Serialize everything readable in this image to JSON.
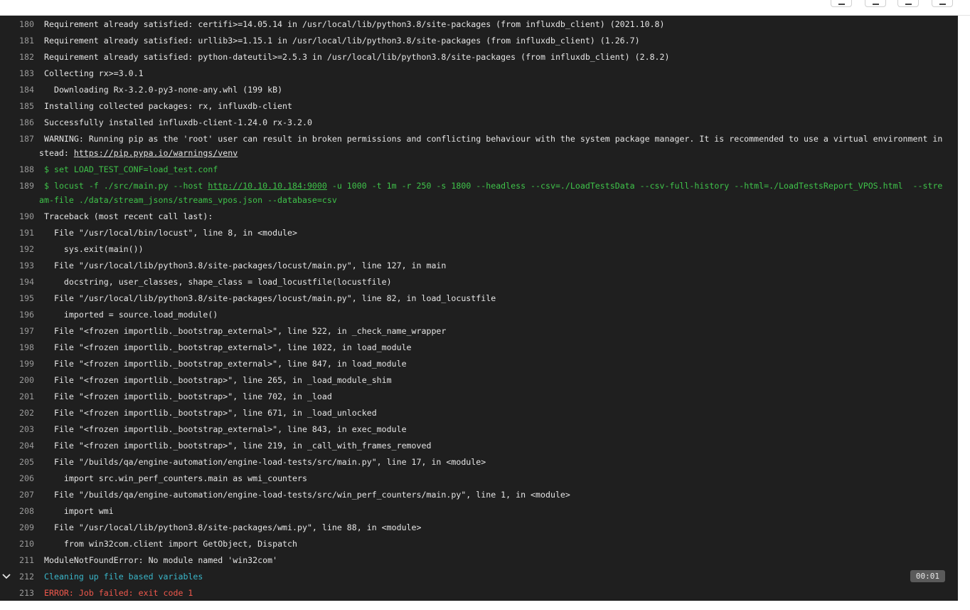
{
  "lines": [
    {
      "n": "180",
      "text": "Requirement already satisfied: certifi>=14.05.14 in /usr/local/lib/python3.8/site-packages (from influxdb_client) (2021.10.8)"
    },
    {
      "n": "181",
      "text": "Requirement already satisfied: urllib3>=1.15.1 in /usr/local/lib/python3.8/site-packages (from influxdb_client) (1.26.7)"
    },
    {
      "n": "182",
      "text": "Requirement already satisfied: python-dateutil>=2.5.3 in /usr/local/lib/python3.8/site-packages (from influxdb_client) (2.8.2)"
    },
    {
      "n": "183",
      "text": "Collecting rx>=3.0.1"
    },
    {
      "n": "184",
      "text": "  Downloading Rx-3.2.0-py3-none-any.whl (199 kB)"
    },
    {
      "n": "185",
      "text": "Installing collected packages: rx, influxdb-client"
    },
    {
      "n": "186",
      "text": "Successfully installed influxdb-client-1.24.0 rx-3.2.0"
    },
    {
      "n": "187",
      "text": "WARNING: Running pip as the 'root' user can result in broken permissions and conflicting behaviour with the system package manager. It is recommended to use a virtual environment instead: ",
      "link": "https://pip.pypa.io/warnings/venv"
    },
    {
      "n": "188",
      "text": "$ set LOAD_TEST_CONF=load_test.conf",
      "color": "green"
    },
    {
      "n": "189",
      "text": "$ locust -f ./src/main.py --host ",
      "link": "http://10.10.10.184:9000",
      "after": " -u 1000 -t 1m -r 250 -s 1800 --headless --csv=./LoadTestsData --csv-full-history --html=./LoadTestsReport_VPOS.html  --stream-file ./data/stream_jsons/streams_vpos.json --database=csv",
      "color": "green"
    },
    {
      "n": "190",
      "text": "Traceback (most recent call last):"
    },
    {
      "n": "191",
      "text": "  File \"/usr/local/bin/locust\", line 8, in <module>"
    },
    {
      "n": "192",
      "text": "    sys.exit(main())"
    },
    {
      "n": "193",
      "text": "  File \"/usr/local/lib/python3.8/site-packages/locust/main.py\", line 127, in main"
    },
    {
      "n": "194",
      "text": "    docstring, user_classes, shape_class = load_locustfile(locustfile)"
    },
    {
      "n": "195",
      "text": "  File \"/usr/local/lib/python3.8/site-packages/locust/main.py\", line 82, in load_locustfile"
    },
    {
      "n": "196",
      "text": "    imported = source.load_module()"
    },
    {
      "n": "197",
      "text": "  File \"<frozen importlib._bootstrap_external>\", line 522, in _check_name_wrapper"
    },
    {
      "n": "198",
      "text": "  File \"<frozen importlib._bootstrap_external>\", line 1022, in load_module"
    },
    {
      "n": "199",
      "text": "  File \"<frozen importlib._bootstrap_external>\", line 847, in load_module"
    },
    {
      "n": "200",
      "text": "  File \"<frozen importlib._bootstrap>\", line 265, in _load_module_shim"
    },
    {
      "n": "201",
      "text": "  File \"<frozen importlib._bootstrap>\", line 702, in _load"
    },
    {
      "n": "202",
      "text": "  File \"<frozen importlib._bootstrap>\", line 671, in _load_unlocked"
    },
    {
      "n": "203",
      "text": "  File \"<frozen importlib._bootstrap_external>\", line 843, in exec_module"
    },
    {
      "n": "204",
      "text": "  File \"<frozen importlib._bootstrap>\", line 219, in _call_with_frames_removed"
    },
    {
      "n": "205",
      "text": "  File \"/builds/qa/engine-automation/engine-load-tests/src/main.py\", line 17, in <module>"
    },
    {
      "n": "206",
      "text": "    import src.win_perf_counters.main as wmi_counters"
    },
    {
      "n": "207",
      "text": "  File \"/builds/qa/engine-automation/engine-load-tests/src/win_perf_counters/main.py\", line 1, in <module>"
    },
    {
      "n": "208",
      "text": "    import wmi"
    },
    {
      "n": "209",
      "text": "  File \"/usr/local/lib/python3.8/site-packages/wmi.py\", line 88, in <module>"
    },
    {
      "n": "210",
      "text": "    from win32com.client import GetObject, Dispatch"
    },
    {
      "n": "211",
      "text": "ModuleNotFoundError: No module named 'win32com'"
    },
    {
      "n": "212",
      "text": "Cleaning up file based variables",
      "color": "cyan",
      "collapsible": true,
      "duration": "00:01"
    },
    {
      "n": "213",
      "text": "ERROR: Job failed: exit code 1",
      "color": "red"
    }
  ],
  "colors": {
    "background": "#1f1f1f",
    "text": "#e5e5e5",
    "green": "#3fc34a",
    "cyan": "#3ab6c9",
    "red": "#f0584c",
    "line_number": "#9a9a9a"
  },
  "toolbar_icons": [
    "scroll-top-icon",
    "scroll-bottom-icon",
    "raw-log-icon",
    "erase-log-icon"
  ]
}
